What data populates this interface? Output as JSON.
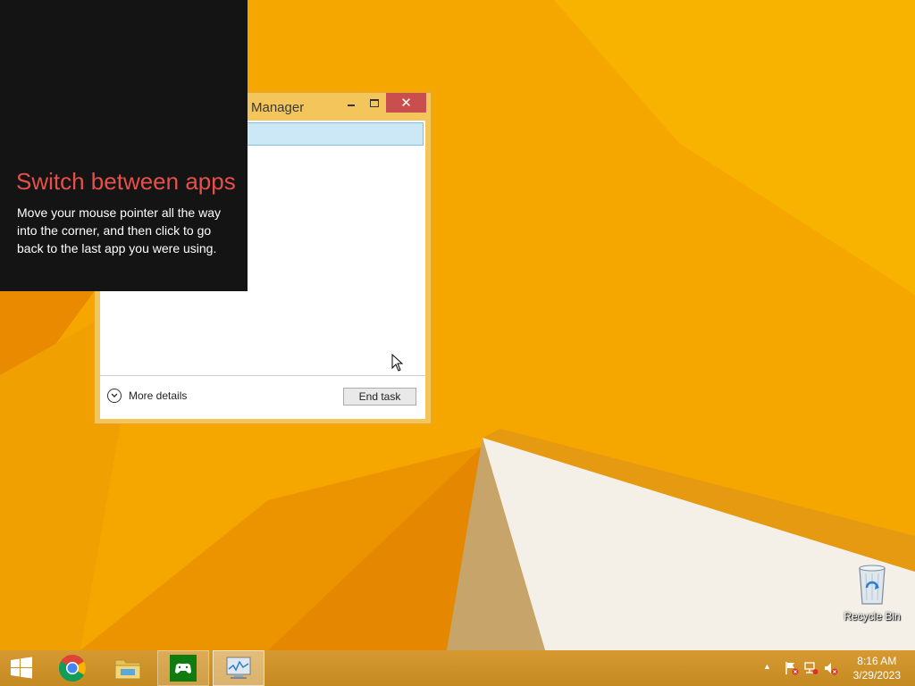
{
  "tip": {
    "heading": "Switch between apps",
    "body": "Move your mouse pointer all the way into the corner, and then click to go back to the last app you were using."
  },
  "task_manager": {
    "title": "Manager",
    "close_symbol": "✕",
    "more_details_label": "More details",
    "end_task_label": "End task"
  },
  "desktop": {
    "recycle_bin_label": "Recycle Bin"
  },
  "taskbar": {
    "pinned": [
      "start-icon",
      "chrome-icon",
      "file-explorer-icon",
      "xbox-games-icon",
      "task-manager-icon"
    ],
    "tray_chevron": "▲",
    "time": "8:16 AM",
    "date": "3/29/2023"
  },
  "colors": {
    "wallpaper": "#f5a800",
    "tip_background": "#141414",
    "tip_heading": "#e5504a",
    "close_button": "#c94f4f",
    "selected_row": "#cce8f7"
  }
}
